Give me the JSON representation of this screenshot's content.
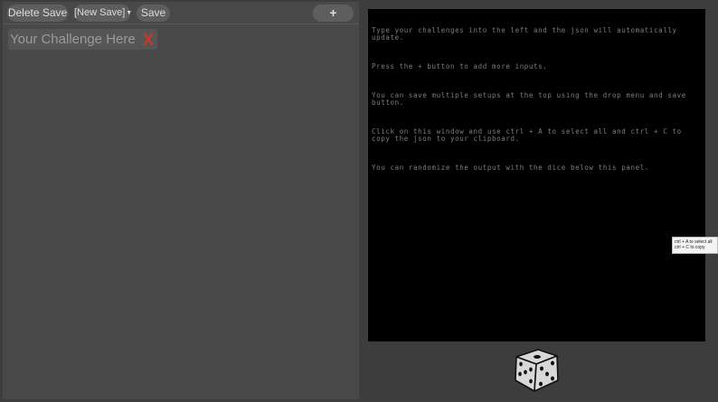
{
  "toolbar": {
    "delete_label": "Delete Save",
    "save_select_value": "[New Save]",
    "save_label": "Save",
    "add_label": "+"
  },
  "challenges": [
    {
      "placeholder": "Your Challenge Here"
    }
  ],
  "output": {
    "lines": [
      "Type your challenges into the left and the json will automatically update.",
      "Press the + button to add more inputs.",
      "You can save multiple setups at the top using the drop menu and save button.",
      "Click on this window and use ctrl + A to select all and ctrl + C to copy the json to your clipboard.",
      "You can randomize the output with the dice below this panel."
    ]
  },
  "tooltip": {
    "line1": "ctrl + A to select all",
    "line2": "ctrl + C to copy"
  },
  "colors": {
    "page_bg": "#3d3d3d",
    "panel_bg": "#494949",
    "button_bg": "#5e5e5e",
    "output_bg": "#000000",
    "remove_red": "#c0392b"
  },
  "icons": {
    "remove": "x-icon",
    "randomize": "dice-icon"
  }
}
